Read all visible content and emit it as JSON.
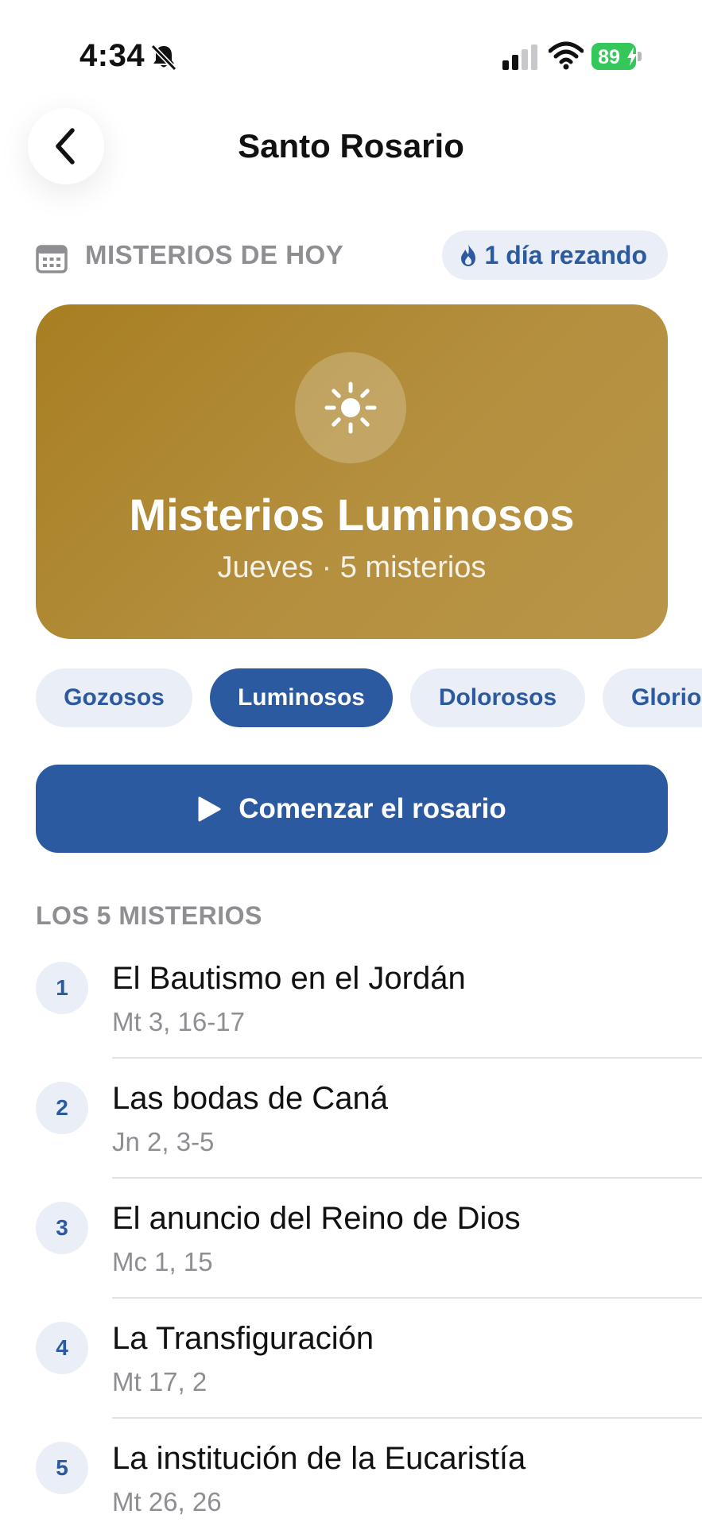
{
  "status_bar": {
    "time": "4:34",
    "battery": "89",
    "icons": [
      "bell-slash-icon",
      "cellular-signal-icon",
      "wifi-icon",
      "battery-charging-icon"
    ]
  },
  "header": {
    "title": "Santo Rosario",
    "back_icon": "chevron-left-icon"
  },
  "section": {
    "label": "MISTERIOS DE HOY",
    "icon": "calendar-icon",
    "streak": "1 día rezando",
    "streak_icon": "flame-icon"
  },
  "hero": {
    "icon": "sun-icon",
    "title": "Misterios Luminosos",
    "subtitle": "Jueves · 5 misterios",
    "colors": {
      "gradient_start": "#a87e22",
      "gradient_end": "#b89549"
    }
  },
  "chips": [
    {
      "label": "Gozosos",
      "active": false
    },
    {
      "label": "Luminosos",
      "active": true
    },
    {
      "label": "Dolorosos",
      "active": false
    },
    {
      "label": "Gloriosos",
      "active": false
    }
  ],
  "start_button": {
    "label": "Comenzar el rosario",
    "icon": "play-icon"
  },
  "list": {
    "heading": "LOS 5 MISTERIOS",
    "items": [
      {
        "number": "1",
        "title": "El Bautismo en el Jordán",
        "ref": "Mt 3, 16-17"
      },
      {
        "number": "2",
        "title": "Las bodas de Caná",
        "ref": "Jn 2, 3-5"
      },
      {
        "number": "3",
        "title": "El anuncio del Reino de Dios",
        "ref": "Mc 1, 15"
      },
      {
        "number": "4",
        "title": "La Transfiguración",
        "ref": "Mt 17, 2"
      },
      {
        "number": "5",
        "title": "La institución de la Eucaristía",
        "ref": "Mt 26, 26"
      }
    ]
  },
  "colors": {
    "accent": "#2c5aa0",
    "chip_bg": "#e9eef7",
    "muted": "#8e8e93",
    "battery": "#34c759"
  }
}
